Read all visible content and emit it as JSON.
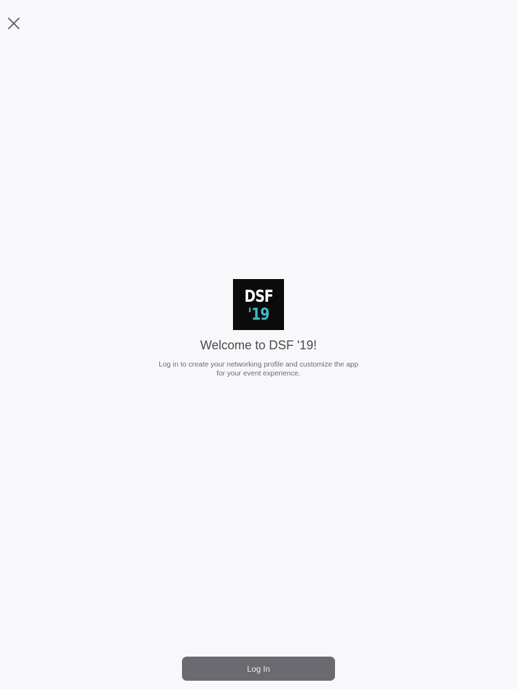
{
  "header": {
    "close_icon": "close-icon"
  },
  "logo": {
    "line1": "DSF",
    "line2": "'19",
    "background_color": "#0b0b0b",
    "line1_color": "#ffffff",
    "line2_color": "#3fb8c6"
  },
  "welcome": {
    "title": "Welcome to DSF '19!",
    "description": "Log in to create your networking profile and customize the app for your event experience."
  },
  "footer": {
    "login_label": "Log In",
    "button_color": "#6b6a70"
  }
}
